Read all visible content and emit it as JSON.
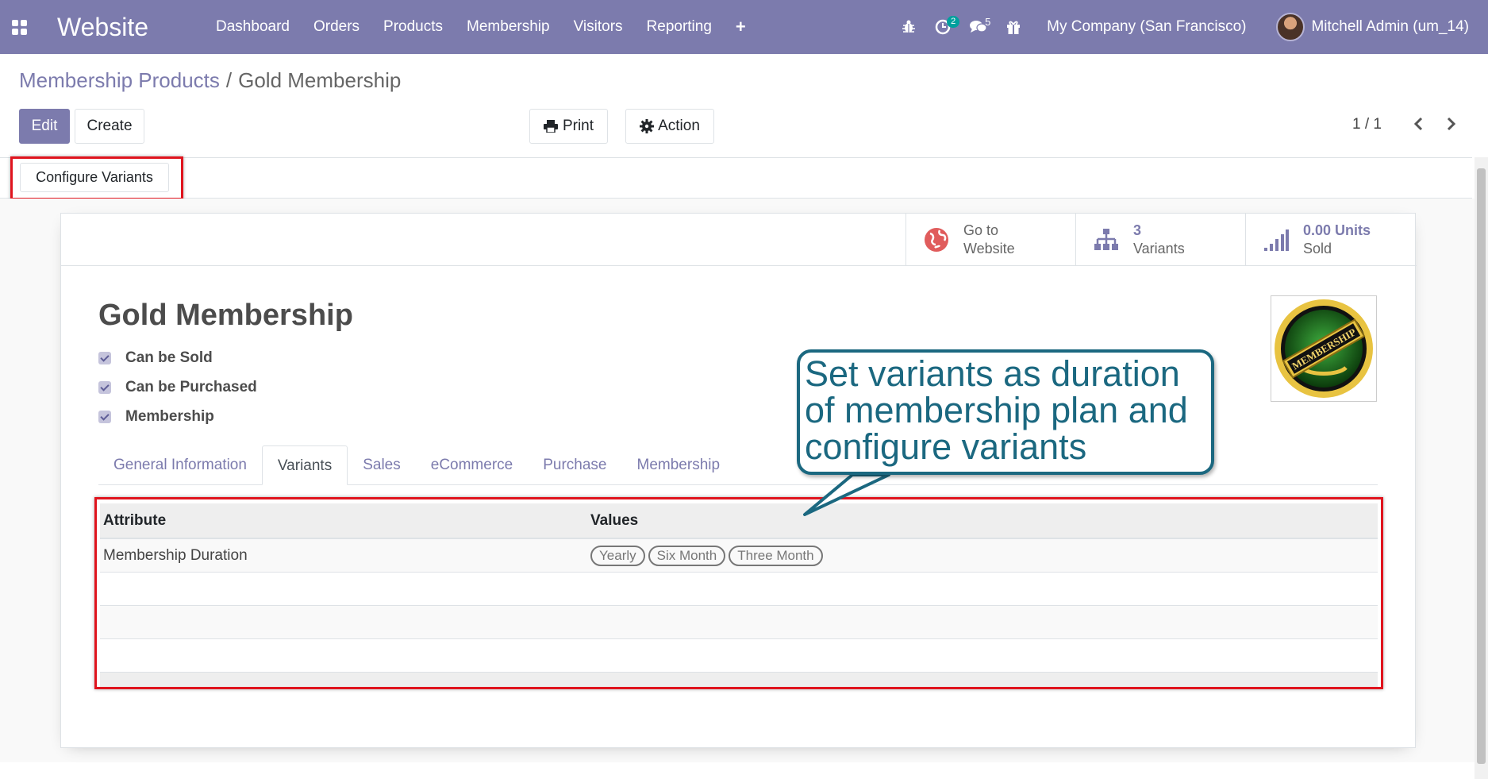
{
  "navbar": {
    "brand": "Website",
    "menu": [
      "Dashboard",
      "Orders",
      "Products",
      "Membership",
      "Visitors",
      "Reporting"
    ],
    "plus": "+",
    "activity_badge": "2",
    "messages_badge": "5",
    "company": "My Company (San Francisco)",
    "user": "Mitchell Admin (um_14)"
  },
  "breadcrumb": {
    "parent": "Membership Products",
    "separator": "/",
    "current": "Gold Membership"
  },
  "actions": {
    "edit": "Edit",
    "create": "Create",
    "print": "Print",
    "action": "Action"
  },
  "pager": {
    "value": "1 / 1"
  },
  "statusbar": {
    "configure_variants": "Configure Variants"
  },
  "smart_buttons": {
    "website": {
      "line1": "Go to",
      "line2": "Website"
    },
    "variants": {
      "value": "3",
      "label": "Variants"
    },
    "sold": {
      "value": "0.00 Units",
      "label": "Sold"
    }
  },
  "product": {
    "name": "Gold Membership",
    "checks": [
      "Can be Sold",
      "Can be Purchased",
      "Membership"
    ],
    "image_text": "MEMBERSHIP"
  },
  "tabs": [
    "General Information",
    "Variants",
    "Sales",
    "eCommerce",
    "Purchase",
    "Membership"
  ],
  "active_tab": "Variants",
  "variants_table": {
    "headers": [
      "Attribute",
      "Values"
    ],
    "rows": [
      {
        "attribute": "Membership Duration",
        "values": [
          "Yearly",
          "Six Month",
          "Three Month"
        ]
      }
    ]
  },
  "callout": {
    "text": "Set variants as duration of membership plan and configure variants"
  },
  "colors": {
    "brand": "#7c7bad",
    "highlight": "#e0141e",
    "callout": "#1b6880"
  }
}
